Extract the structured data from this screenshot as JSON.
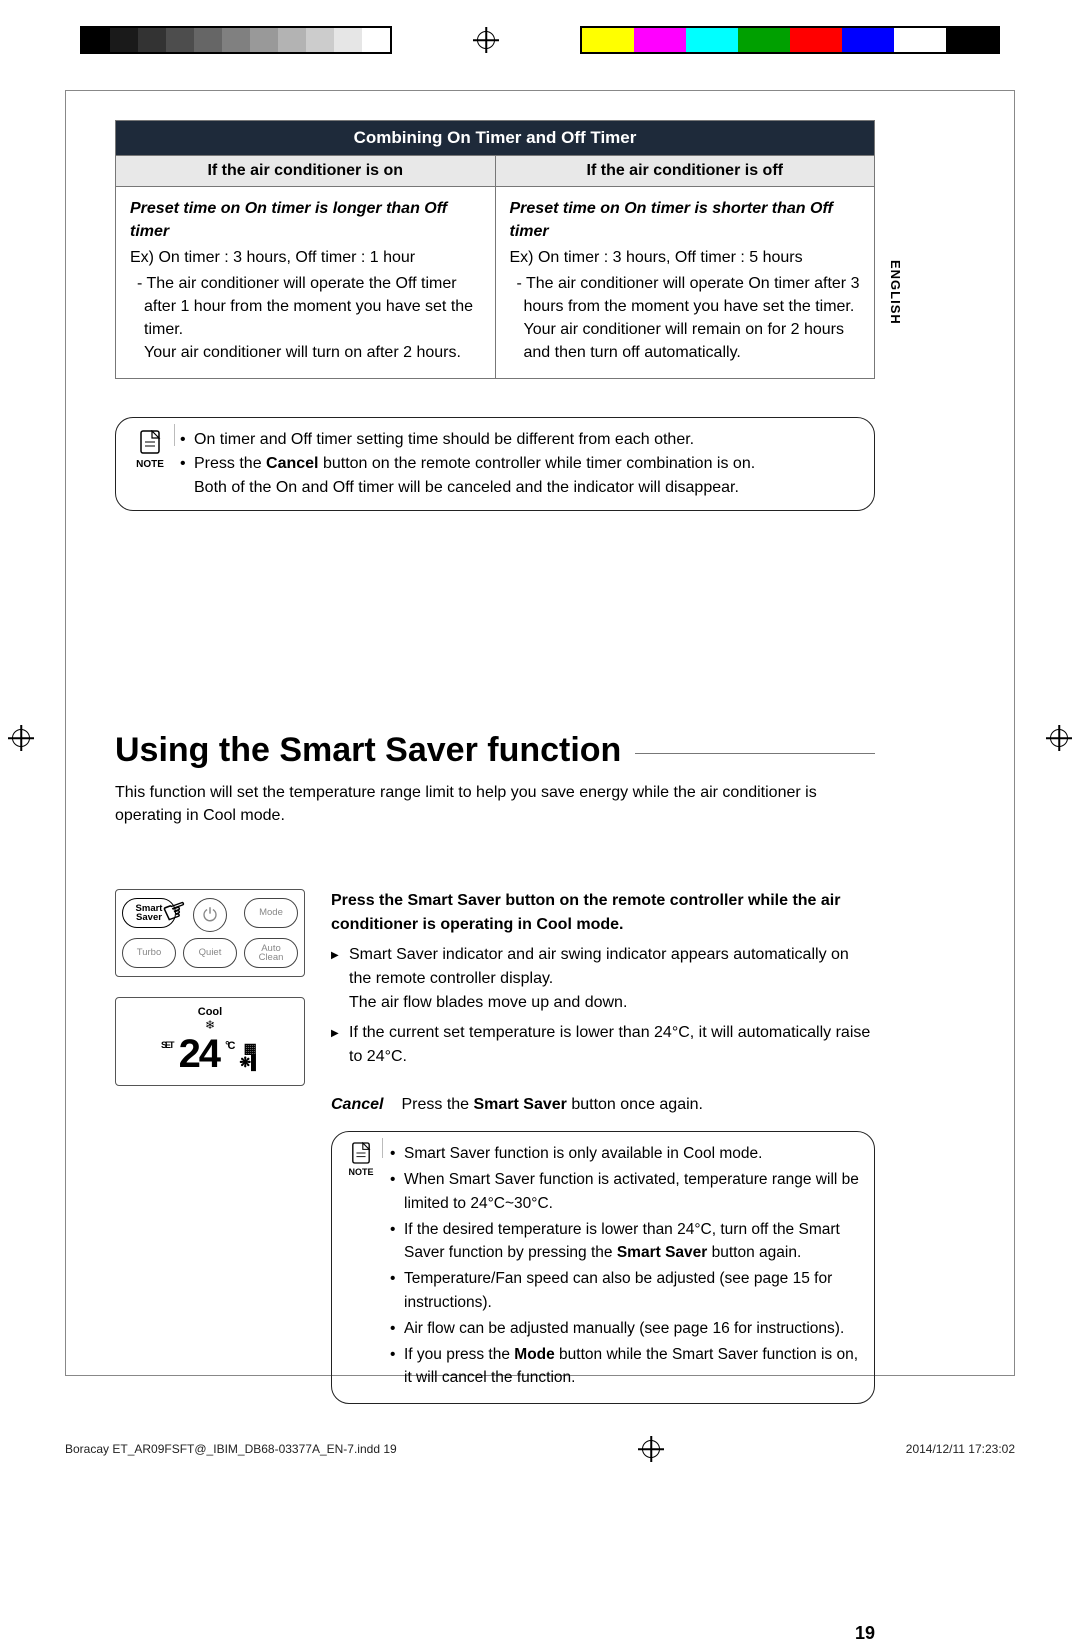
{
  "language_tab": "ENGLISH",
  "table": {
    "title": "Combining On Timer and Off Timer",
    "col_on_header": "If the air conditioner is on",
    "col_off_header": "If the air conditioner is off",
    "left": {
      "preset": "Preset time on On timer is longer than Off timer",
      "example": "Ex) On timer : 3 hours, Off timer : 1 hour",
      "bullet1": "- The air conditioner will operate the Off timer after 1 hour from the moment you have set the timer.",
      "bullet2": "Your air conditioner will turn on after 2 hours."
    },
    "right": {
      "preset": "Preset time on On timer is shorter than Off timer",
      "example": "Ex) On timer : 3 hours, Off timer : 5 hours",
      "bullet1": "- The air conditioner will operate On timer after 3 hours from the moment you have set the timer.",
      "bullet2": "Your air conditioner will remain on for 2 hours and then turn off automatically."
    }
  },
  "note1": {
    "label": "NOTE",
    "item1": "On timer and Off timer setting time should be different from each other.",
    "item2a": "Press the ",
    "item2_bold": "Cancel",
    "item2b": " button on the remote controller while timer combination is on.",
    "item2c": "Both of the On and Off timer will be canceled and the indicator will disappear."
  },
  "section_title": "Using the Smart Saver function",
  "intro": "This function will set the temperature range limit to help you save energy while the air conditioner is operating in Cool mode.",
  "remote": {
    "smart_saver": "Smart\nSaver",
    "mode": "Mode",
    "turbo": "Turbo",
    "quiet": "Quiet",
    "auto_clean": "Auto\nClean"
  },
  "display": {
    "cool": "Cool",
    "set": "SET",
    "temp": "24",
    "degc": "°C"
  },
  "ss": {
    "lead_a": "Press the ",
    "lead_bold": "Smart Saver",
    "lead_b": " button on the remote controller while the air conditioner is operating in Cool mode.",
    "arrow1a": "Smart Saver indicator and air swing indicator appears automatically on the remote controller display.",
    "arrow1b": "The air flow blades move up and down.",
    "arrow2": "If the current set temperature is lower than 24°C, it will automatically raise to 24°C."
  },
  "cancel": {
    "label": "Cancel",
    "text_a": "Press the ",
    "text_bold": "Smart Saver",
    "text_b": " button once again."
  },
  "note2": {
    "label": "NOTE",
    "i1": "Smart Saver function is only available in Cool mode.",
    "i2": "When Smart Saver function is activated, temperature range will be limited to 24°C~30°C.",
    "i3a": "If the desired temperature is lower than 24°C, turn off the Smart Saver function by pressing the ",
    "i3_bold": "Smart Saver",
    "i3b": " button again.",
    "i4": "Temperature/Fan speed can also be adjusted (see page 15 for instructions).",
    "i5": "Air flow can be adjusted manually (see page 16 for instructions).",
    "i6a": "If you press the ",
    "i6_bold": "Mode",
    "i6b": " button while the Smart Saver function is on, it will cancel the function."
  },
  "page_number": "19",
  "footer_left": "Boracay ET_AR09FSFT@_IBIM_DB68-03377A_EN-7.indd   19",
  "footer_right": "2014/12/11   17:23:02"
}
